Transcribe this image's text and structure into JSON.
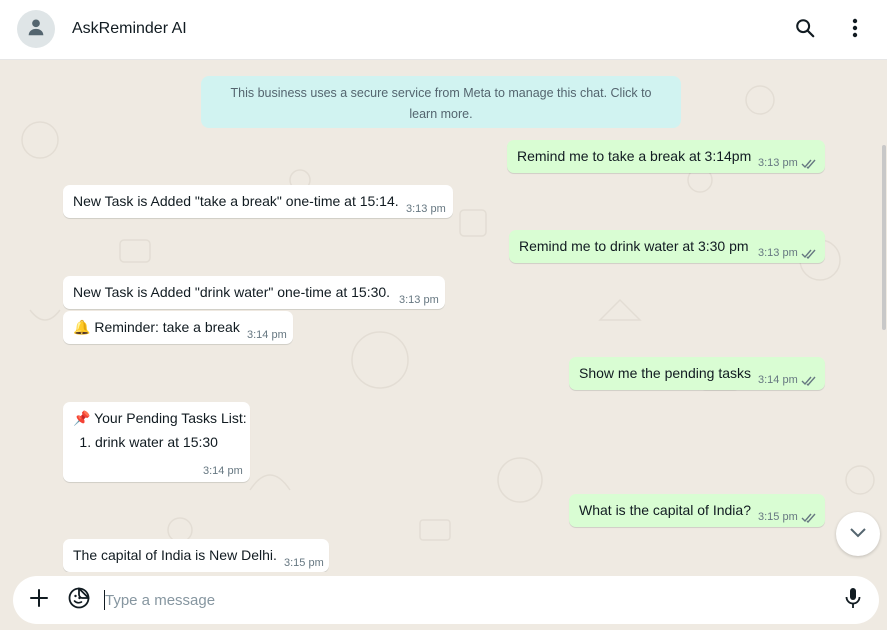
{
  "header": {
    "title": "AskReminder AI",
    "avatar_icon": "user-icon",
    "search_icon": "search-icon",
    "menu_icon": "kebab-menu-icon"
  },
  "notice": {
    "text": "This business uses a secure service from Meta to manage this chat. Click to learn more."
  },
  "messages": [
    {
      "dir": "out",
      "text": "Remind me to take a break at 3:14pm",
      "time": "3:13 pm"
    },
    {
      "dir": "in",
      "text": "New Task is Added \"take a break\" one-time at 15:14.",
      "time": "3:13 pm"
    },
    {
      "dir": "out",
      "text": "Remind me to drink water at 3:30 pm",
      "time": "3:13 pm"
    },
    {
      "dir": "in",
      "text": "New Task is Added \"drink water\" one-time at 15:30.",
      "time": "3:13 pm"
    },
    {
      "dir": "in",
      "text": "Reminder: take a break",
      "emoji": "🔔",
      "time": "3:14 pm"
    },
    {
      "dir": "out",
      "text": "Show me the pending tasks",
      "time": "3:14 pm"
    },
    {
      "dir": "in",
      "text": "Your Pending Tasks List:",
      "emoji": "📌",
      "list": [
        "drink water at 15:30"
      ],
      "time": "3:14 pm"
    },
    {
      "dir": "out",
      "text": "What is the capital of India?",
      "time": "3:15 pm"
    },
    {
      "dir": "in",
      "text": "The capital of India is New Delhi.",
      "time": "3:15 pm"
    }
  ],
  "composer": {
    "placeholder": "Type a message",
    "value": "",
    "attach_icon": "plus-icon",
    "sticker_icon": "sticker-icon",
    "mic_icon": "microphone-icon"
  },
  "scroll_button_icon": "chevron-down-icon",
  "colors": {
    "outgoing_bubble": "#d9fdd3",
    "incoming_bubble": "#ffffff",
    "chat_background": "#efeae2",
    "notice_background": "#d1f3f1",
    "read_ticks": "#53bdeb"
  }
}
